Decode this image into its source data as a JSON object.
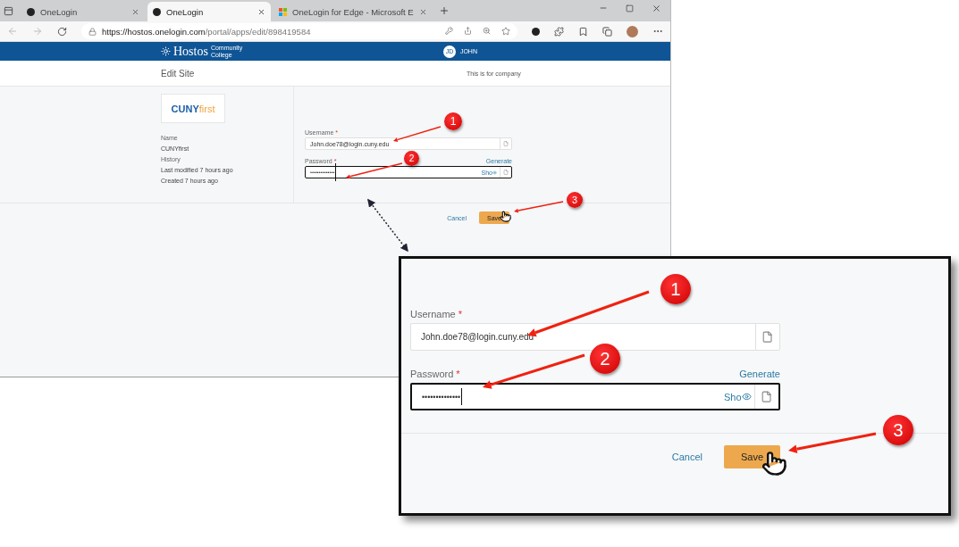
{
  "browser": {
    "tabs": [
      {
        "title": "OneLogin",
        "selected": false,
        "kind": "onelogin"
      },
      {
        "title": "OneLogin",
        "selected": true,
        "kind": "onelogin"
      },
      {
        "title": "OneLogin for Edge - Microsoft E",
        "selected": false,
        "kind": "store"
      }
    ],
    "url_host": "https://hostos.onelogin.com",
    "url_path": "/portal/apps/edit/898419584"
  },
  "header": {
    "logo": "Hostos",
    "logo_sub": "Community College",
    "user_initials": "JD",
    "user_name": "JOHN"
  },
  "subheader": {
    "title": "Edit Site",
    "note": "This is for company"
  },
  "app": {
    "logo_primary": "CUNY",
    "logo_secondary": "first",
    "details": [
      {
        "label": "Name",
        "lines": [
          "CUNYfirst"
        ]
      },
      {
        "label": "History",
        "lines": [
          "Last modified 7 hours ago",
          "Created 7 hours ago"
        ]
      }
    ]
  },
  "form": {
    "username_label": "Username",
    "username_value": "John.doe78@login.cuny.edu",
    "password_label": "Password",
    "required_mark": "*",
    "generate": "Generate",
    "password_value": "••••••••••••••",
    "show": "Sho",
    "cancel": "Cancel",
    "save": "Save"
  },
  "callout": {
    "username_label": "Username",
    "username_value": "John.doe78@login.cuny.edu",
    "password_label": "Password",
    "required_mark": "*",
    "generate": "Generate",
    "password_value": "••••••••••••••",
    "show": "Sho",
    "cancel": "Cancel",
    "save": "Save"
  },
  "markers": [
    "1",
    "2",
    "3",
    "1",
    "2",
    "3"
  ]
}
